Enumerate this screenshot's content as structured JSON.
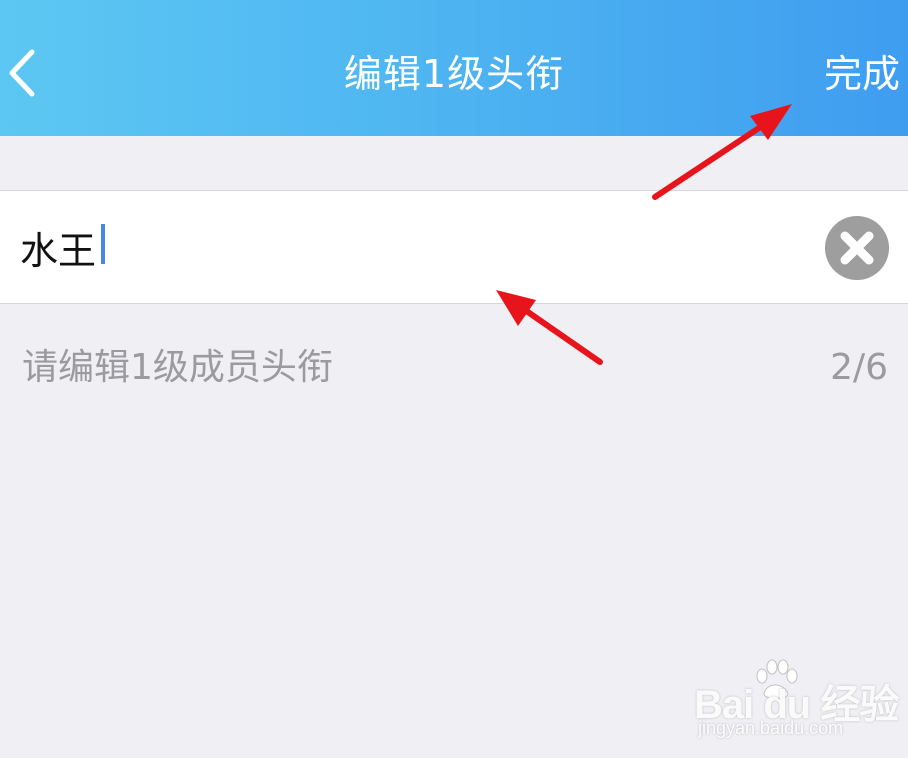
{
  "header": {
    "title": "编辑1级头衔",
    "back_icon": "chevron-left-icon",
    "done_label": "完成"
  },
  "input": {
    "value": "水王",
    "clear_icon": "clear-circle-icon"
  },
  "hint": {
    "text": "请编辑1级成员头衔",
    "counter": "2/6"
  },
  "watermark": {
    "brand": "Bai du 经验",
    "url": "jingyan.baidu.com"
  },
  "colors": {
    "header_start": "#5dc7f3",
    "header_end": "#3f9df0",
    "background": "#efeff4",
    "annotation_arrow": "#e8141c",
    "cursor": "#4a86e8"
  }
}
